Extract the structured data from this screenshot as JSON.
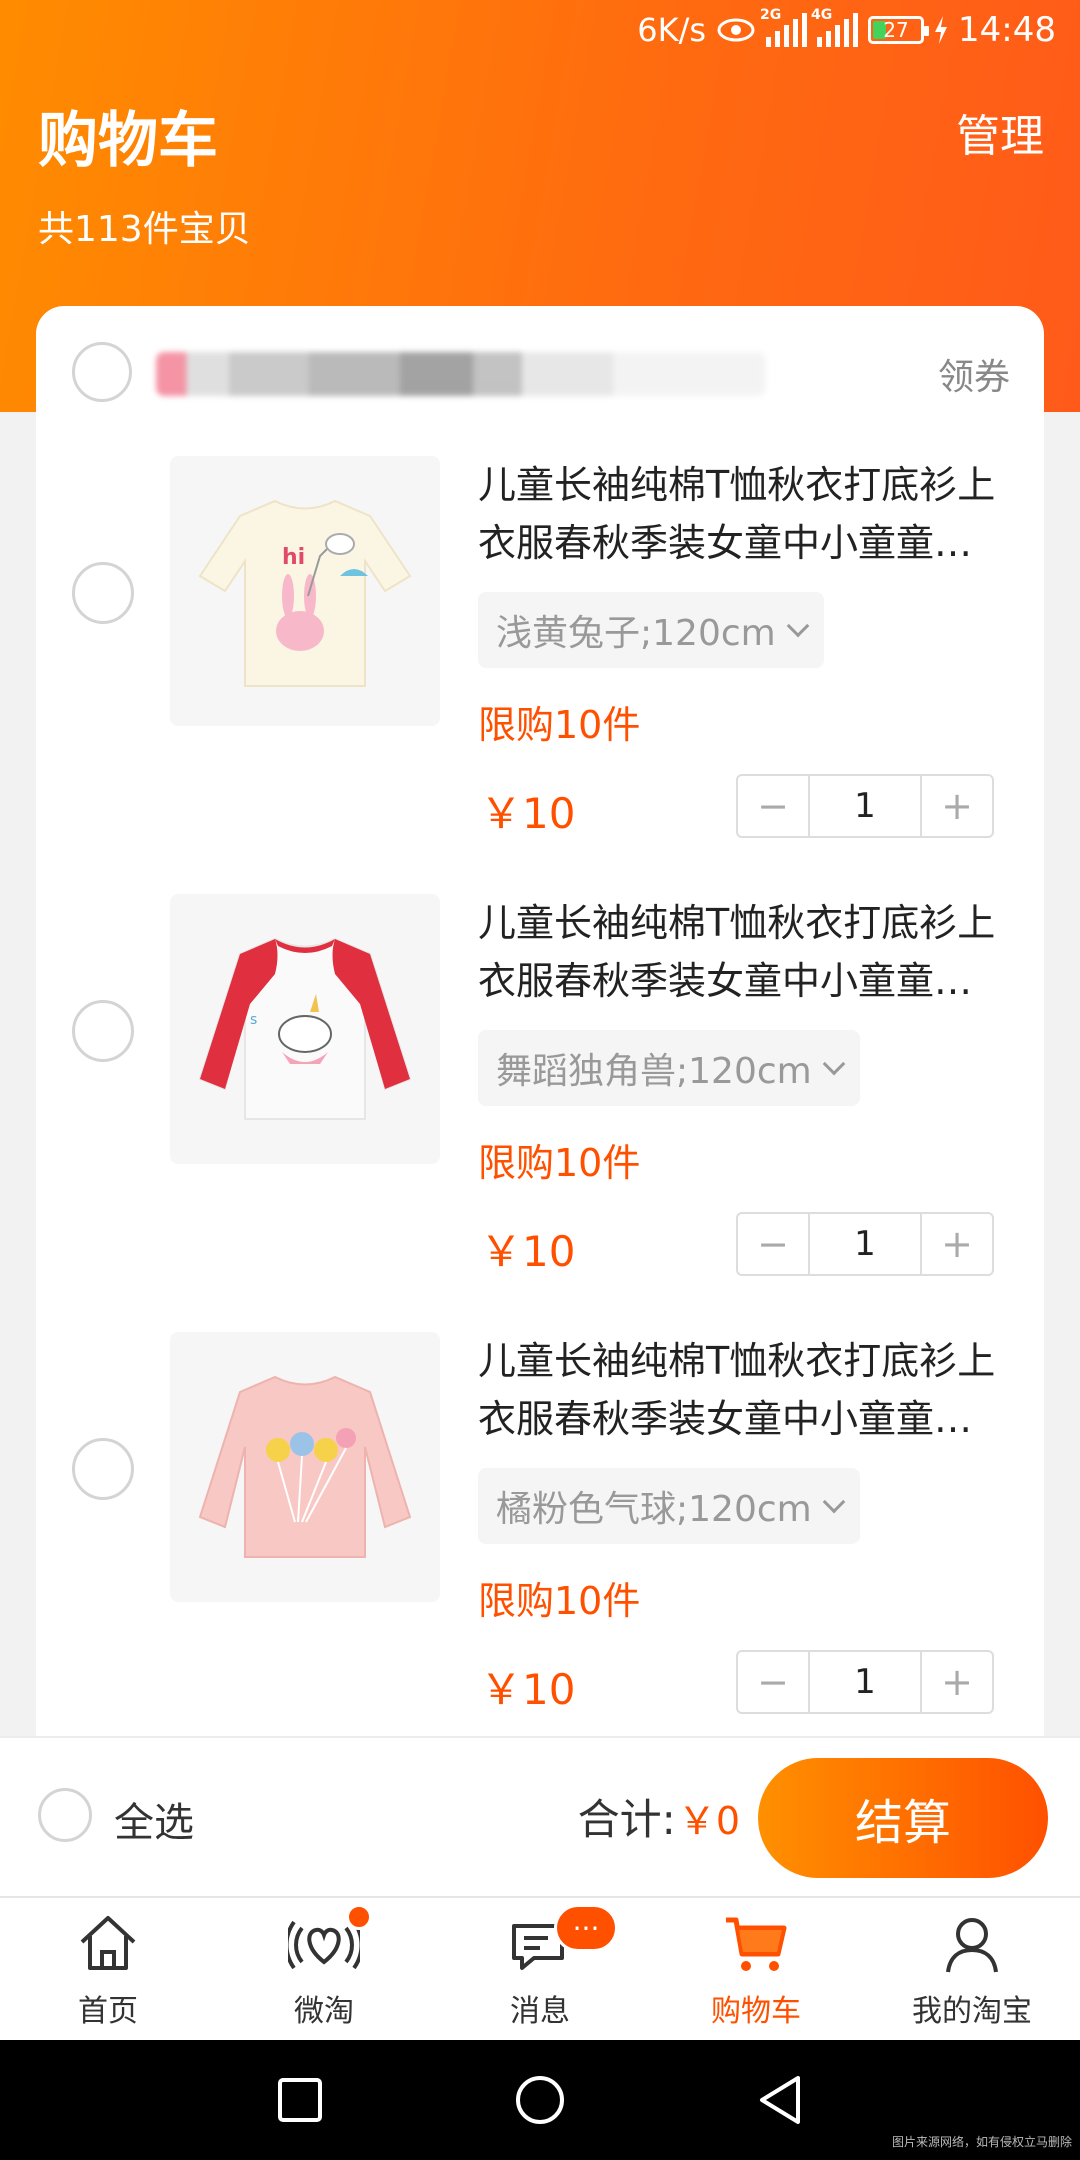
{
  "status_bar": {
    "net_speed": "6K/s",
    "sim1": "2G",
    "sim2": "4G",
    "battery": "27",
    "time": "14:48"
  },
  "header": {
    "title": "购物车",
    "manage": "管理",
    "count_text": "共113件宝贝"
  },
  "shop": {
    "coupon": "领券"
  },
  "items": [
    {
      "title": "儿童长袖纯棉T恤秋衣打底衫上衣服春秋季装女童中小童童…",
      "sku": "浅黄兔子;120cm",
      "limit": "限购10件",
      "price": "￥10",
      "qty": "1",
      "minus": "−",
      "plus": "+"
    },
    {
      "title": "儿童长袖纯棉T恤秋衣打底衫上衣服春秋季装女童中小童童…",
      "sku": "舞蹈独角兽;120cm",
      "limit": "限购10件",
      "price": "￥10",
      "qty": "1",
      "minus": "−",
      "plus": "+"
    },
    {
      "title": "儿童长袖纯棉T恤秋衣打底衫上衣服春秋季装女童中小童童…",
      "sku": "橘粉色气球;120cm",
      "limit": "限购10件",
      "price": "￥10",
      "qty": "1",
      "minus": "−",
      "plus": "+"
    }
  ],
  "footer": {
    "select_all": "全选",
    "total_label": "合计:",
    "total_value": "￥0",
    "checkout": "结算"
  },
  "tabs": [
    {
      "label": "首页",
      "icon": "home-icon"
    },
    {
      "label": "微淘",
      "icon": "heart-wave-icon"
    },
    {
      "label": "消息",
      "icon": "message-icon",
      "badge": "···"
    },
    {
      "label": "购物车",
      "icon": "cart-icon"
    },
    {
      "label": "我的淘宝",
      "icon": "user-icon"
    }
  ],
  "watermark": "图片来源网络，如有侵权立马删除",
  "colors": {
    "accent": "#ff5000",
    "header_start": "#ff8c00",
    "header_end": "#ff5a1a"
  }
}
